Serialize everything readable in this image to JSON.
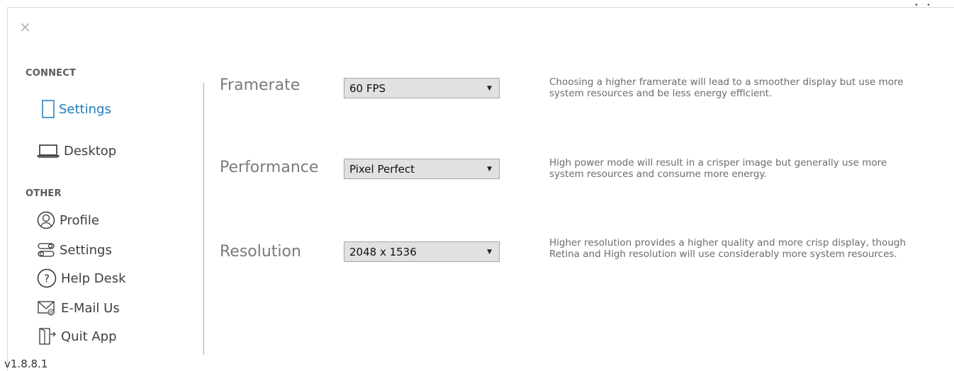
{
  "window": {
    "close_symbol": "×",
    "bg_dots": "• •"
  },
  "sidebar": {
    "connect_title": "CONNECT",
    "connect_items": [
      {
        "label": "Settings",
        "icon": "tablet-icon",
        "active": true
      },
      {
        "label": "Desktop",
        "icon": "laptop-icon",
        "active": false
      }
    ],
    "other_title": "OTHER",
    "other_items": [
      {
        "label": "Profile",
        "icon": "profile-icon"
      },
      {
        "label": "Settings",
        "icon": "toggles-icon"
      },
      {
        "label": "Help Desk",
        "icon": "help-icon"
      },
      {
        "label": "E-Mail Us",
        "icon": "mail-icon"
      },
      {
        "label": "Quit App",
        "icon": "exit-door-icon"
      }
    ],
    "version": "v1.8.8.1"
  },
  "settings": {
    "framerate": {
      "label": "Framerate",
      "value": "60 FPS",
      "description": "Choosing a higher framerate will lead to a smoother display but use more system resources and be less energy efficient."
    },
    "performance": {
      "label": "Performance",
      "value": "Pixel Perfect",
      "description": "High power mode will result in a crisper image but generally use more system resources and consume more energy."
    },
    "resolution": {
      "label": "Resolution",
      "value": "2048 x 1536",
      "description": "Higher resolution provides a higher quality and more crisp display, though Retina and High resolution will use considerably more system resources."
    }
  },
  "colors": {
    "active": "#1f7ab8",
    "select_bg": "#e1e1e1",
    "label_gray": "#7b7b7b"
  }
}
